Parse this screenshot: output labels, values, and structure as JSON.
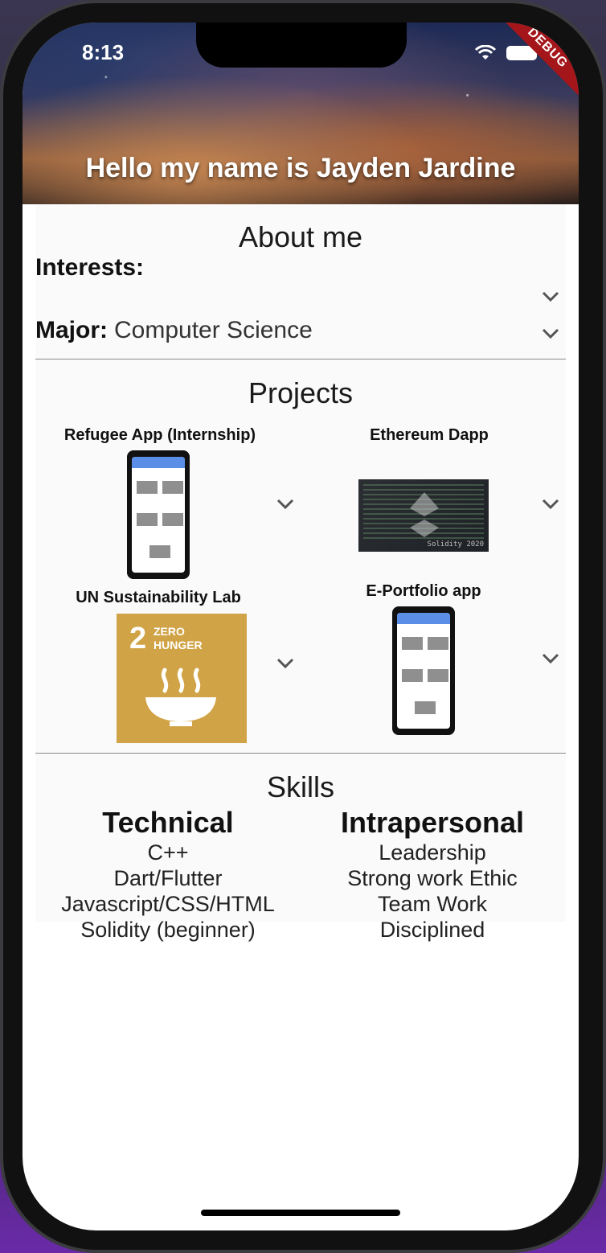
{
  "status_bar": {
    "time": "8:13",
    "debug_label": "DEBUG"
  },
  "header": {
    "title": "Hello my name is Jayden Jardine"
  },
  "about": {
    "title": "About me",
    "interests_label": "Interests:",
    "major_label": "Major:",
    "major_value": "Computer Science"
  },
  "projects": {
    "title": "Projects",
    "items": [
      {
        "title": "Refugee App (Internship)"
      },
      {
        "title": "Ethereum Dapp",
        "image_caption": "Solidity 2020"
      },
      {
        "title": "UN Sustainability Lab",
        "image_number": "2",
        "image_line1": "ZERO",
        "image_line2": "HUNGER"
      },
      {
        "title": "E-Portfolio app"
      }
    ]
  },
  "skills": {
    "title": "Skills",
    "technical": {
      "heading": "Technical",
      "items": [
        "C++",
        "Dart/Flutter",
        "Javascript/CSS/HTML",
        "Solidity (beginner)"
      ]
    },
    "intrapersonal": {
      "heading": "Intrapersonal",
      "items": [
        "Leadership",
        "Strong work Ethic",
        "Team Work",
        "Disciplined"
      ]
    }
  },
  "colors": {
    "accent_blue": "#5b8ee6",
    "sdg_gold": "#d0a346",
    "debug_red": "#a4161a"
  },
  "icons": [
    "chevron-down-icon",
    "wifi-icon",
    "battery-icon"
  ]
}
